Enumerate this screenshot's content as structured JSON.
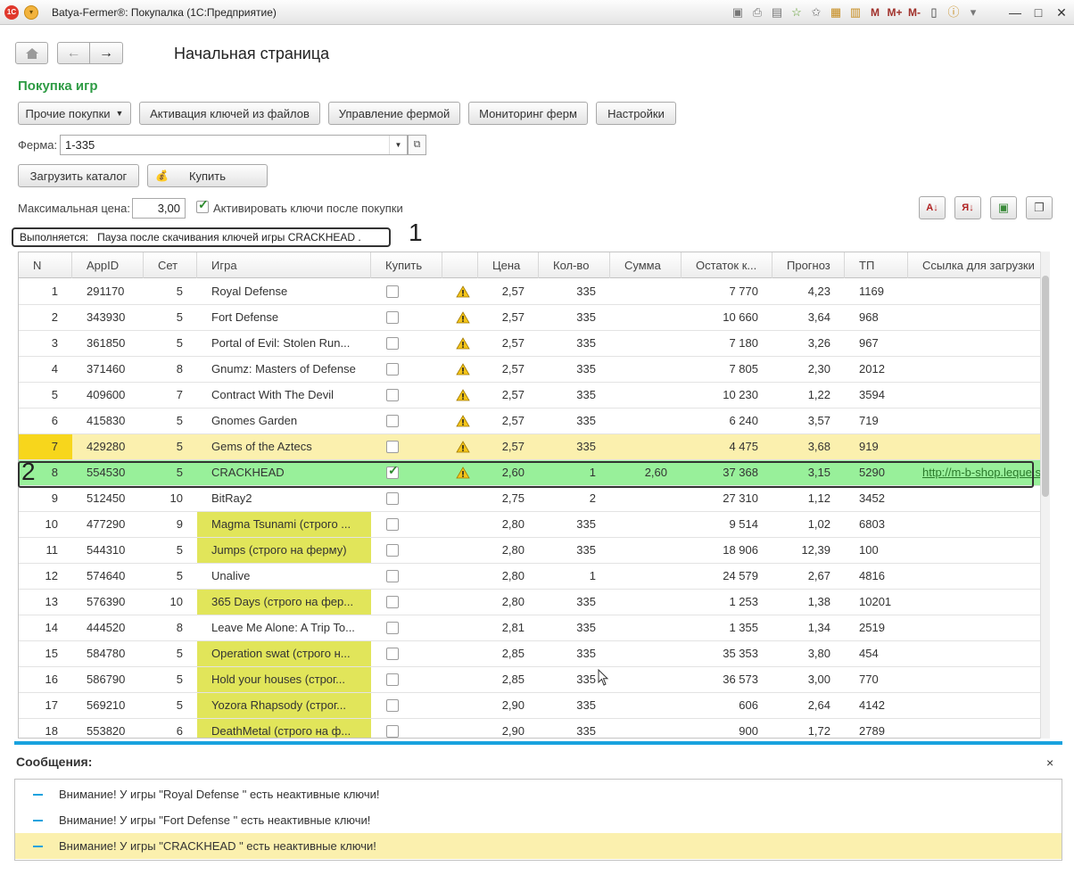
{
  "window": {
    "title": "Batya-Fermer®: Покупалка  (1С:Предприятие)",
    "logo_text": "1С",
    "win_buttons": [
      "—",
      "□",
      "✕"
    ]
  },
  "nav": {
    "page_title": "Начальная страница"
  },
  "section": {
    "title": "Покупка игр"
  },
  "toolbar": {
    "buttons": [
      "Прочие покупки",
      "Активация ключей из файлов",
      "Управление фермой",
      "Мониторинг ферм",
      "Настройки"
    ]
  },
  "farm": {
    "label": "Ферма:",
    "value": "1-335"
  },
  "actions": {
    "load_catalog": "Загрузить каталог",
    "buy": "Купить"
  },
  "filters": {
    "max_price_label": "Максимальная цена:",
    "max_price_value": "3,00",
    "activate_label": "Активировать ключи после покупки"
  },
  "status": {
    "text": "Выполняется:   Пауза после скачивания ключей игры CRACKHEAD ."
  },
  "annotations": [
    "1",
    "2"
  ],
  "colors": {
    "accent": "#19a2de",
    "section_title": "#2e9b44",
    "row_yellow": "#fbf0ae",
    "row_yellow_cell": "#f7d61c",
    "row_green": "#98f09a",
    "name_highlight": "#e1e55a",
    "msg_highlight": "#fbf0ae"
  },
  "table": {
    "columns": [
      "N",
      "AppID",
      "Сет",
      "Игра",
      "Купить",
      "",
      "Цена",
      "Кол-во",
      "Сумма",
      "Остаток к...",
      "Прогноз",
      "ТП",
      "Ссылка для загрузки"
    ],
    "rows": [
      {
        "n": "1",
        "appid": "291170",
        "set": "5",
        "game": "Royal Defense",
        "buy": false,
        "warn": true,
        "price": "2,57",
        "qty": "335",
        "sum": "",
        "rest": "7 770",
        "forecast": "4,23",
        "tp": "1169",
        "link": ""
      },
      {
        "n": "2",
        "appid": "343930",
        "set": "5",
        "game": "Fort Defense",
        "buy": false,
        "warn": true,
        "price": "2,57",
        "qty": "335",
        "sum": "",
        "rest": "10 660",
        "forecast": "3,64",
        "tp": "968",
        "link": ""
      },
      {
        "n": "3",
        "appid": "361850",
        "set": "5",
        "game": "Portal of Evil: Stolen Run...",
        "buy": false,
        "warn": true,
        "price": "2,57",
        "qty": "335",
        "sum": "",
        "rest": "7 180",
        "forecast": "3,26",
        "tp": "967",
        "link": ""
      },
      {
        "n": "4",
        "appid": "371460",
        "set": "8",
        "game": "Gnumz: Masters of Defense",
        "buy": false,
        "warn": true,
        "price": "2,57",
        "qty": "335",
        "sum": "",
        "rest": "7 805",
        "forecast": "2,30",
        "tp": "2012",
        "link": ""
      },
      {
        "n": "5",
        "appid": "409600",
        "set": "7",
        "game": "Contract With The Devil",
        "buy": false,
        "warn": true,
        "price": "2,57",
        "qty": "335",
        "sum": "",
        "rest": "10 230",
        "forecast": "1,22",
        "tp": "3594",
        "link": ""
      },
      {
        "n": "6",
        "appid": "415830",
        "set": "5",
        "game": "Gnomes Garden",
        "buy": false,
        "warn": true,
        "price": "2,57",
        "qty": "335",
        "sum": "",
        "rest": "6 240",
        "forecast": "3,57",
        "tp": "719",
        "link": ""
      },
      {
        "n": "7",
        "appid": "429280",
        "set": "5",
        "game": "Gems of the Aztecs",
        "buy": false,
        "warn": true,
        "price": "2,57",
        "qty": "335",
        "sum": "",
        "rest": "4 475",
        "forecast": "3,68",
        "tp": "919",
        "link": "",
        "state": "selected"
      },
      {
        "n": "8",
        "appid": "554530",
        "set": "5",
        "game": "CRACKHEAD",
        "buy": true,
        "warn": true,
        "price": "2,60",
        "qty": "1",
        "sum": "2,60",
        "rest": "37 368",
        "forecast": "3,15",
        "tp": "5290",
        "link": "http://m-b-shop.leque.s",
        "state": "bought"
      },
      {
        "n": "9",
        "appid": "512450",
        "set": "10",
        "game": "BitRay2",
        "buy": false,
        "warn": false,
        "price": "2,75",
        "qty": "2",
        "sum": "",
        "rest": "27 310",
        "forecast": "1,12",
        "tp": "3452",
        "link": ""
      },
      {
        "n": "10",
        "appid": "477290",
        "set": "9",
        "game": "Magma Tsunami  (строго ...",
        "buy": false,
        "warn": false,
        "price": "2,80",
        "qty": "335",
        "sum": "",
        "rest": "9 514",
        "forecast": "1,02",
        "tp": "6803",
        "link": "",
        "name_hl": true
      },
      {
        "n": "11",
        "appid": "544310",
        "set": "5",
        "game": "Jumps  (строго на ферму)",
        "buy": false,
        "warn": false,
        "price": "2,80",
        "qty": "335",
        "sum": "",
        "rest": "18 906",
        "forecast": "12,39",
        "tp": "100",
        "link": "",
        "name_hl": true
      },
      {
        "n": "12",
        "appid": "574640",
        "set": "5",
        "game": "Unalive",
        "buy": false,
        "warn": false,
        "price": "2,80",
        "qty": "1",
        "sum": "",
        "rest": "24 579",
        "forecast": "2,67",
        "tp": "4816",
        "link": ""
      },
      {
        "n": "13",
        "appid": "576390",
        "set": "10",
        "game": "365 Days  (строго на фер...",
        "buy": false,
        "warn": false,
        "price": "2,80",
        "qty": "335",
        "sum": "",
        "rest": "1 253",
        "forecast": "1,38",
        "tp": "10201",
        "link": "",
        "name_hl": true
      },
      {
        "n": "14",
        "appid": "444520",
        "set": "8",
        "game": "Leave Me Alone: A Trip To...",
        "buy": false,
        "warn": false,
        "price": "2,81",
        "qty": "335",
        "sum": "",
        "rest": "1 355",
        "forecast": "1,34",
        "tp": "2519",
        "link": ""
      },
      {
        "n": "15",
        "appid": "584780",
        "set": "5",
        "game": "Operation swat  (строго н...",
        "buy": false,
        "warn": false,
        "price": "2,85",
        "qty": "335",
        "sum": "",
        "rest": "35 353",
        "forecast": "3,80",
        "tp": "454",
        "link": "",
        "name_hl": true
      },
      {
        "n": "16",
        "appid": "586790",
        "set": "5",
        "game": "Hold your houses  (строг...",
        "buy": false,
        "warn": false,
        "price": "2,85",
        "qty": "335",
        "sum": "",
        "rest": "36 573",
        "forecast": "3,00",
        "tp": "770",
        "link": "",
        "name_hl": true
      },
      {
        "n": "17",
        "appid": "569210",
        "set": "5",
        "game": "Yozora Rhapsody  (строг...",
        "buy": false,
        "warn": false,
        "price": "2,90",
        "qty": "335",
        "sum": "",
        "rest": "606",
        "forecast": "2,64",
        "tp": "4142",
        "link": "",
        "name_hl": true
      },
      {
        "n": "18",
        "appid": "553820",
        "set": "6",
        "game": "DeathMetal  (строго на ф...",
        "buy": false,
        "warn": false,
        "price": "2,90",
        "qty": "335",
        "sum": "",
        "rest": "900",
        "forecast": "1,72",
        "tp": "2789",
        "link": "",
        "name_hl": true
      }
    ]
  },
  "messages": {
    "title": "Сообщения:",
    "close": "×",
    "items": [
      {
        "text": "Внимание! У игры \"Royal Defense \" есть неактивные ключи!",
        "highlight": false
      },
      {
        "text": "Внимание! У игры \"Fort Defense \" есть неактивные ключи!",
        "highlight": false
      },
      {
        "text": "Внимание! У игры \"CRACKHEAD \" есть неактивные ключи!",
        "highlight": true
      }
    ]
  }
}
